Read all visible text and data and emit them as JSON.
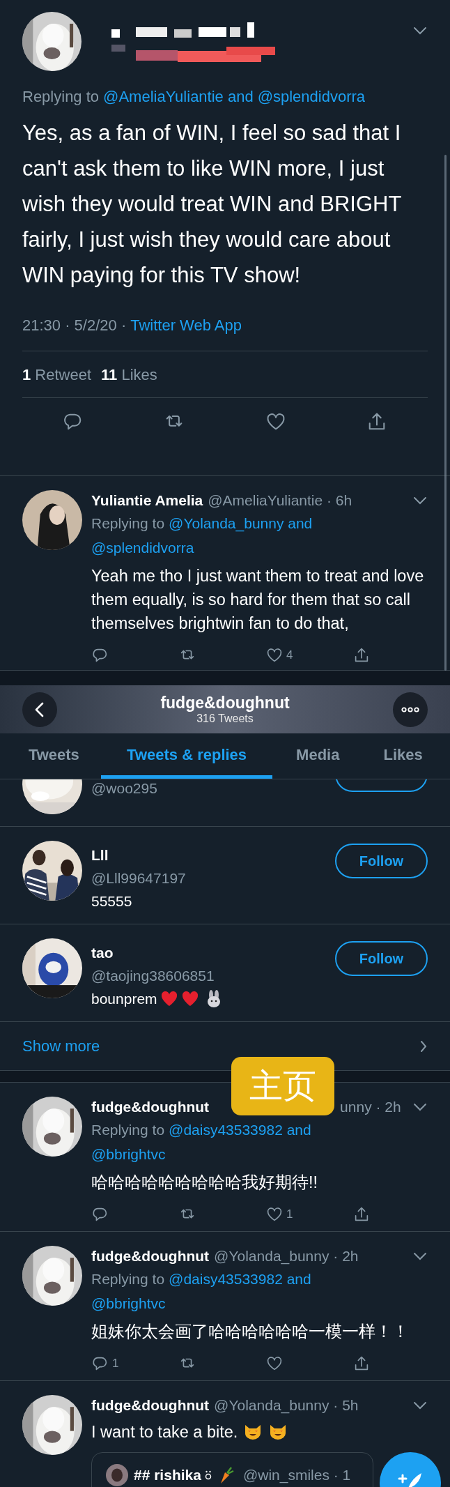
{
  "main_tweet": {
    "replying_label": "Replying to",
    "replying_to": [
      "@AmeliaYuliantie and",
      "@splendidvorra"
    ],
    "text": "Yes, as a fan of WIN, I feel so sad that I can't ask them to like WIN more, I just wish they would treat WIN and BRIGHT fairly, I just wish they would care about WIN paying for this TV show!",
    "time": "21:30 · 5/2/20 ·",
    "source": "Twitter Web App",
    "stats": [
      {
        "count": "1",
        "label": "Retweet"
      },
      {
        "count": "11",
        "label": "Likes"
      }
    ]
  },
  "reply": {
    "name": "Yuliantie Amelia",
    "handle": "@AmeliaYuliantie · 6h",
    "replying_label": "Replying to",
    "replying_to": [
      "@Yolanda_bunny and",
      "@splendidvorra"
    ],
    "text": "Yeah me tho I just want them to treat and love them equally, is so hard for them that so call themselves brightwin fan to do that,",
    "like_count": "4"
  },
  "profile_header": {
    "name": "fudge&doughnut",
    "tweet_count": "316 Tweets"
  },
  "tabs": [
    {
      "label": "Tweets",
      "selected": false
    },
    {
      "label": "Tweets & replies",
      "selected": true
    },
    {
      "label": "Media",
      "selected": false
    },
    {
      "label": "Likes",
      "selected": false
    }
  ],
  "who_to_follow": {
    "partial_handle": "@woo295",
    "users": [
      {
        "name": "Lll",
        "handle": "@Lll99647197",
        "bio": "55555",
        "button": "Follow"
      },
      {
        "name": "tao",
        "handle": "@taojing38606851",
        "bio": "bounprem",
        "button": "Follow"
      }
    ],
    "show_more": "Show more"
  },
  "badge": "主页",
  "tweets": [
    {
      "name": "fudge&doughnut",
      "handle": "unny · 2h",
      "covered": true,
      "replying_label": "Replying to",
      "replying_to": [
        "@daisy43533982 and",
        "@bbrightvc"
      ],
      "text": "哈哈哈哈哈哈哈哈哈我好期待!!",
      "like_count": "1"
    },
    {
      "name": "fudge&doughnut",
      "handle": "@Yolanda_bunny · 2h",
      "covered": false,
      "replying_label": "Replying to",
      "replying_to": [
        "@daisy43533982 and",
        "@bbrightvc"
      ],
      "text": "姐妹你太会画了哈哈哈哈哈哈一模一样！！",
      "reply_count": "1"
    },
    {
      "name": "fudge&doughnut",
      "handle": "@Yolanda_bunny · 5h",
      "covered": false,
      "text": "I want to take a bite.",
      "quote": {
        "name": "## rishika",
        "handle": "@win_smiles · 1"
      }
    }
  ]
}
